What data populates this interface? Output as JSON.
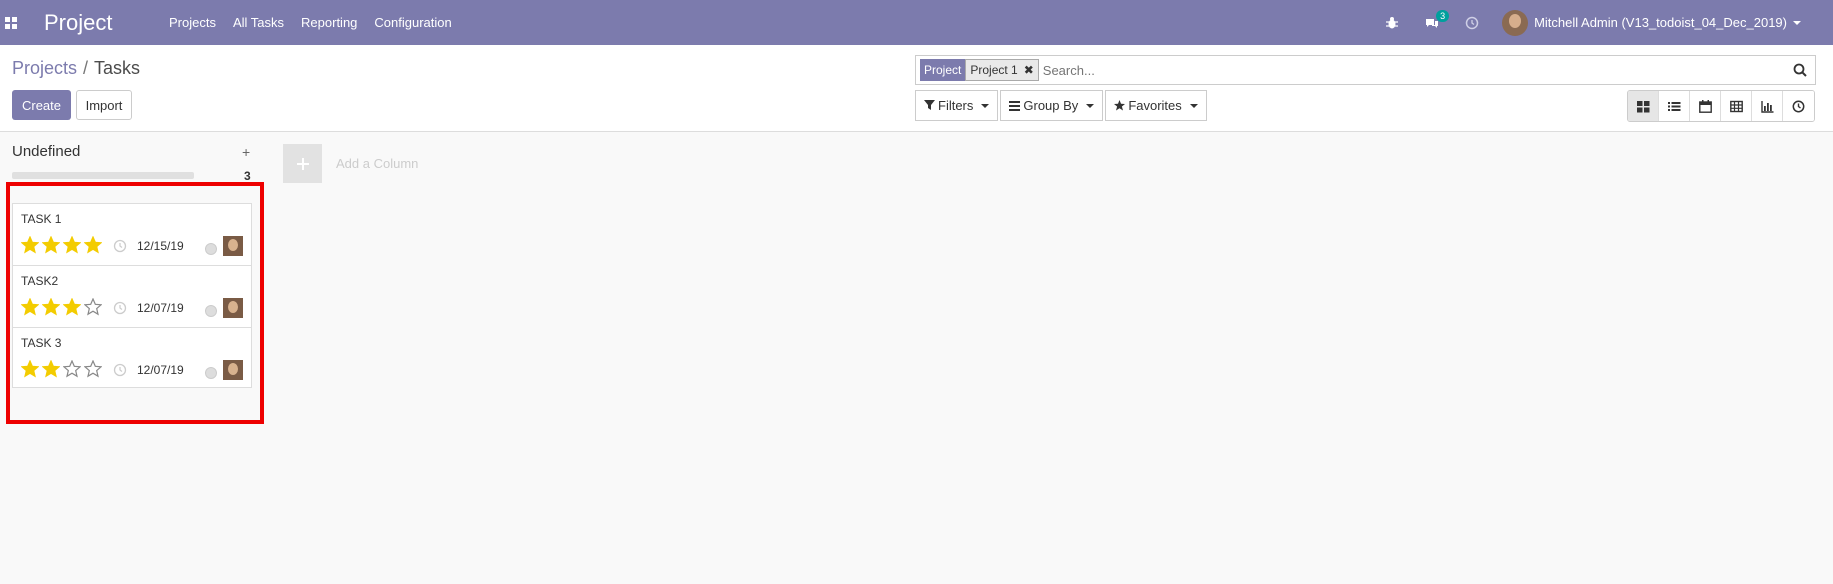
{
  "navbar": {
    "brand": "Project",
    "menu": [
      "Projects",
      "All Tasks",
      "Reporting",
      "Configuration"
    ],
    "messages_badge": "3",
    "user": "Mitchell Admin (V13_todoist_04_Dec_2019)",
    "color": "#7c7bad"
  },
  "breadcrumb": {
    "parent": "Projects",
    "separator": "/",
    "current": "Tasks"
  },
  "buttons": {
    "create": "Create",
    "import": "Import"
  },
  "search": {
    "facet_category": "Project",
    "facet_value": "Project 1",
    "placeholder": "Search..."
  },
  "filters": {
    "filters": "Filters",
    "group_by": "Group By",
    "favorites": "Favorites"
  },
  "views": [
    "kanban",
    "list",
    "calendar",
    "pivot",
    "graph",
    "activity"
  ],
  "active_view": "kanban",
  "column": {
    "title": "Undefined",
    "add": "+",
    "count": "3",
    "add_column_label": "Add a Column"
  },
  "tasks": [
    {
      "title": "TASK 1",
      "priority": 4,
      "date": "12/15/19"
    },
    {
      "title": "TASK2",
      "priority": 3,
      "date": "12/07/19"
    },
    {
      "title": "TASK 3",
      "priority": 2,
      "date": "12/07/19"
    }
  ],
  "colors": {
    "highlight": "#ee0000",
    "star": "#f3cc00",
    "accent": "#7c7bad"
  }
}
